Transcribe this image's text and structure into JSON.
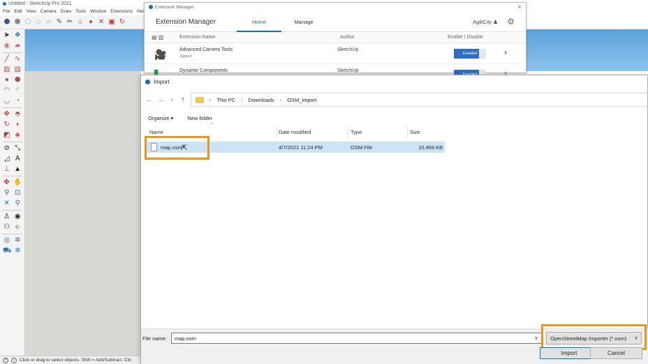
{
  "sketchup": {
    "title": "Untitled - SketchUp Pro 2021",
    "menu": [
      "File",
      "Edit",
      "View",
      "Camera",
      "Draw",
      "Tools",
      "Window",
      "Extensions",
      "Help"
    ],
    "status": "Click or drag to select objects. Shift = Add/Subtract. Ctrl"
  },
  "extension_manager": {
    "window_title": "Extension Manager",
    "heading": "Extension Manager",
    "tabs": [
      "Home",
      "Manage"
    ],
    "active_tab": "Home",
    "user": "AgiliCity",
    "columns": {
      "name": "Extension Name",
      "author": "Author",
      "enable": "Enable | Disable"
    },
    "extensions": [
      {
        "name": "Advanced Camera Tools",
        "signed": "Signed",
        "author": "SketchUp",
        "state": "Enabled"
      },
      {
        "name": "Dynamic Components",
        "signed": "",
        "author": "SketchUp",
        "state": "Enabled"
      }
    ]
  },
  "import_dialog": {
    "title": "Import",
    "breadcrumb": [
      "This PC",
      "Downloads",
      "OSM_import"
    ],
    "organize_label": "Organize",
    "new_folder_label": "New folder",
    "columns": {
      "name": "Name",
      "date": "Date modified",
      "type": "Type",
      "size": "Size"
    },
    "files": [
      {
        "name": "map.osm",
        "date": "4/7/2021 11:24 PM",
        "type": "OSM File",
        "size": "10,469 KB"
      }
    ],
    "file_name_label": "File name:",
    "file_name_value": "map.osm",
    "file_type_value": "OpenStreetMap Importer (*.osm)",
    "import_label": "Import",
    "cancel_label": "Cancel"
  },
  "colors": {
    "highlight": "#f0921e",
    "accent": "#1b6bb8",
    "selection": "#cce4f7"
  }
}
